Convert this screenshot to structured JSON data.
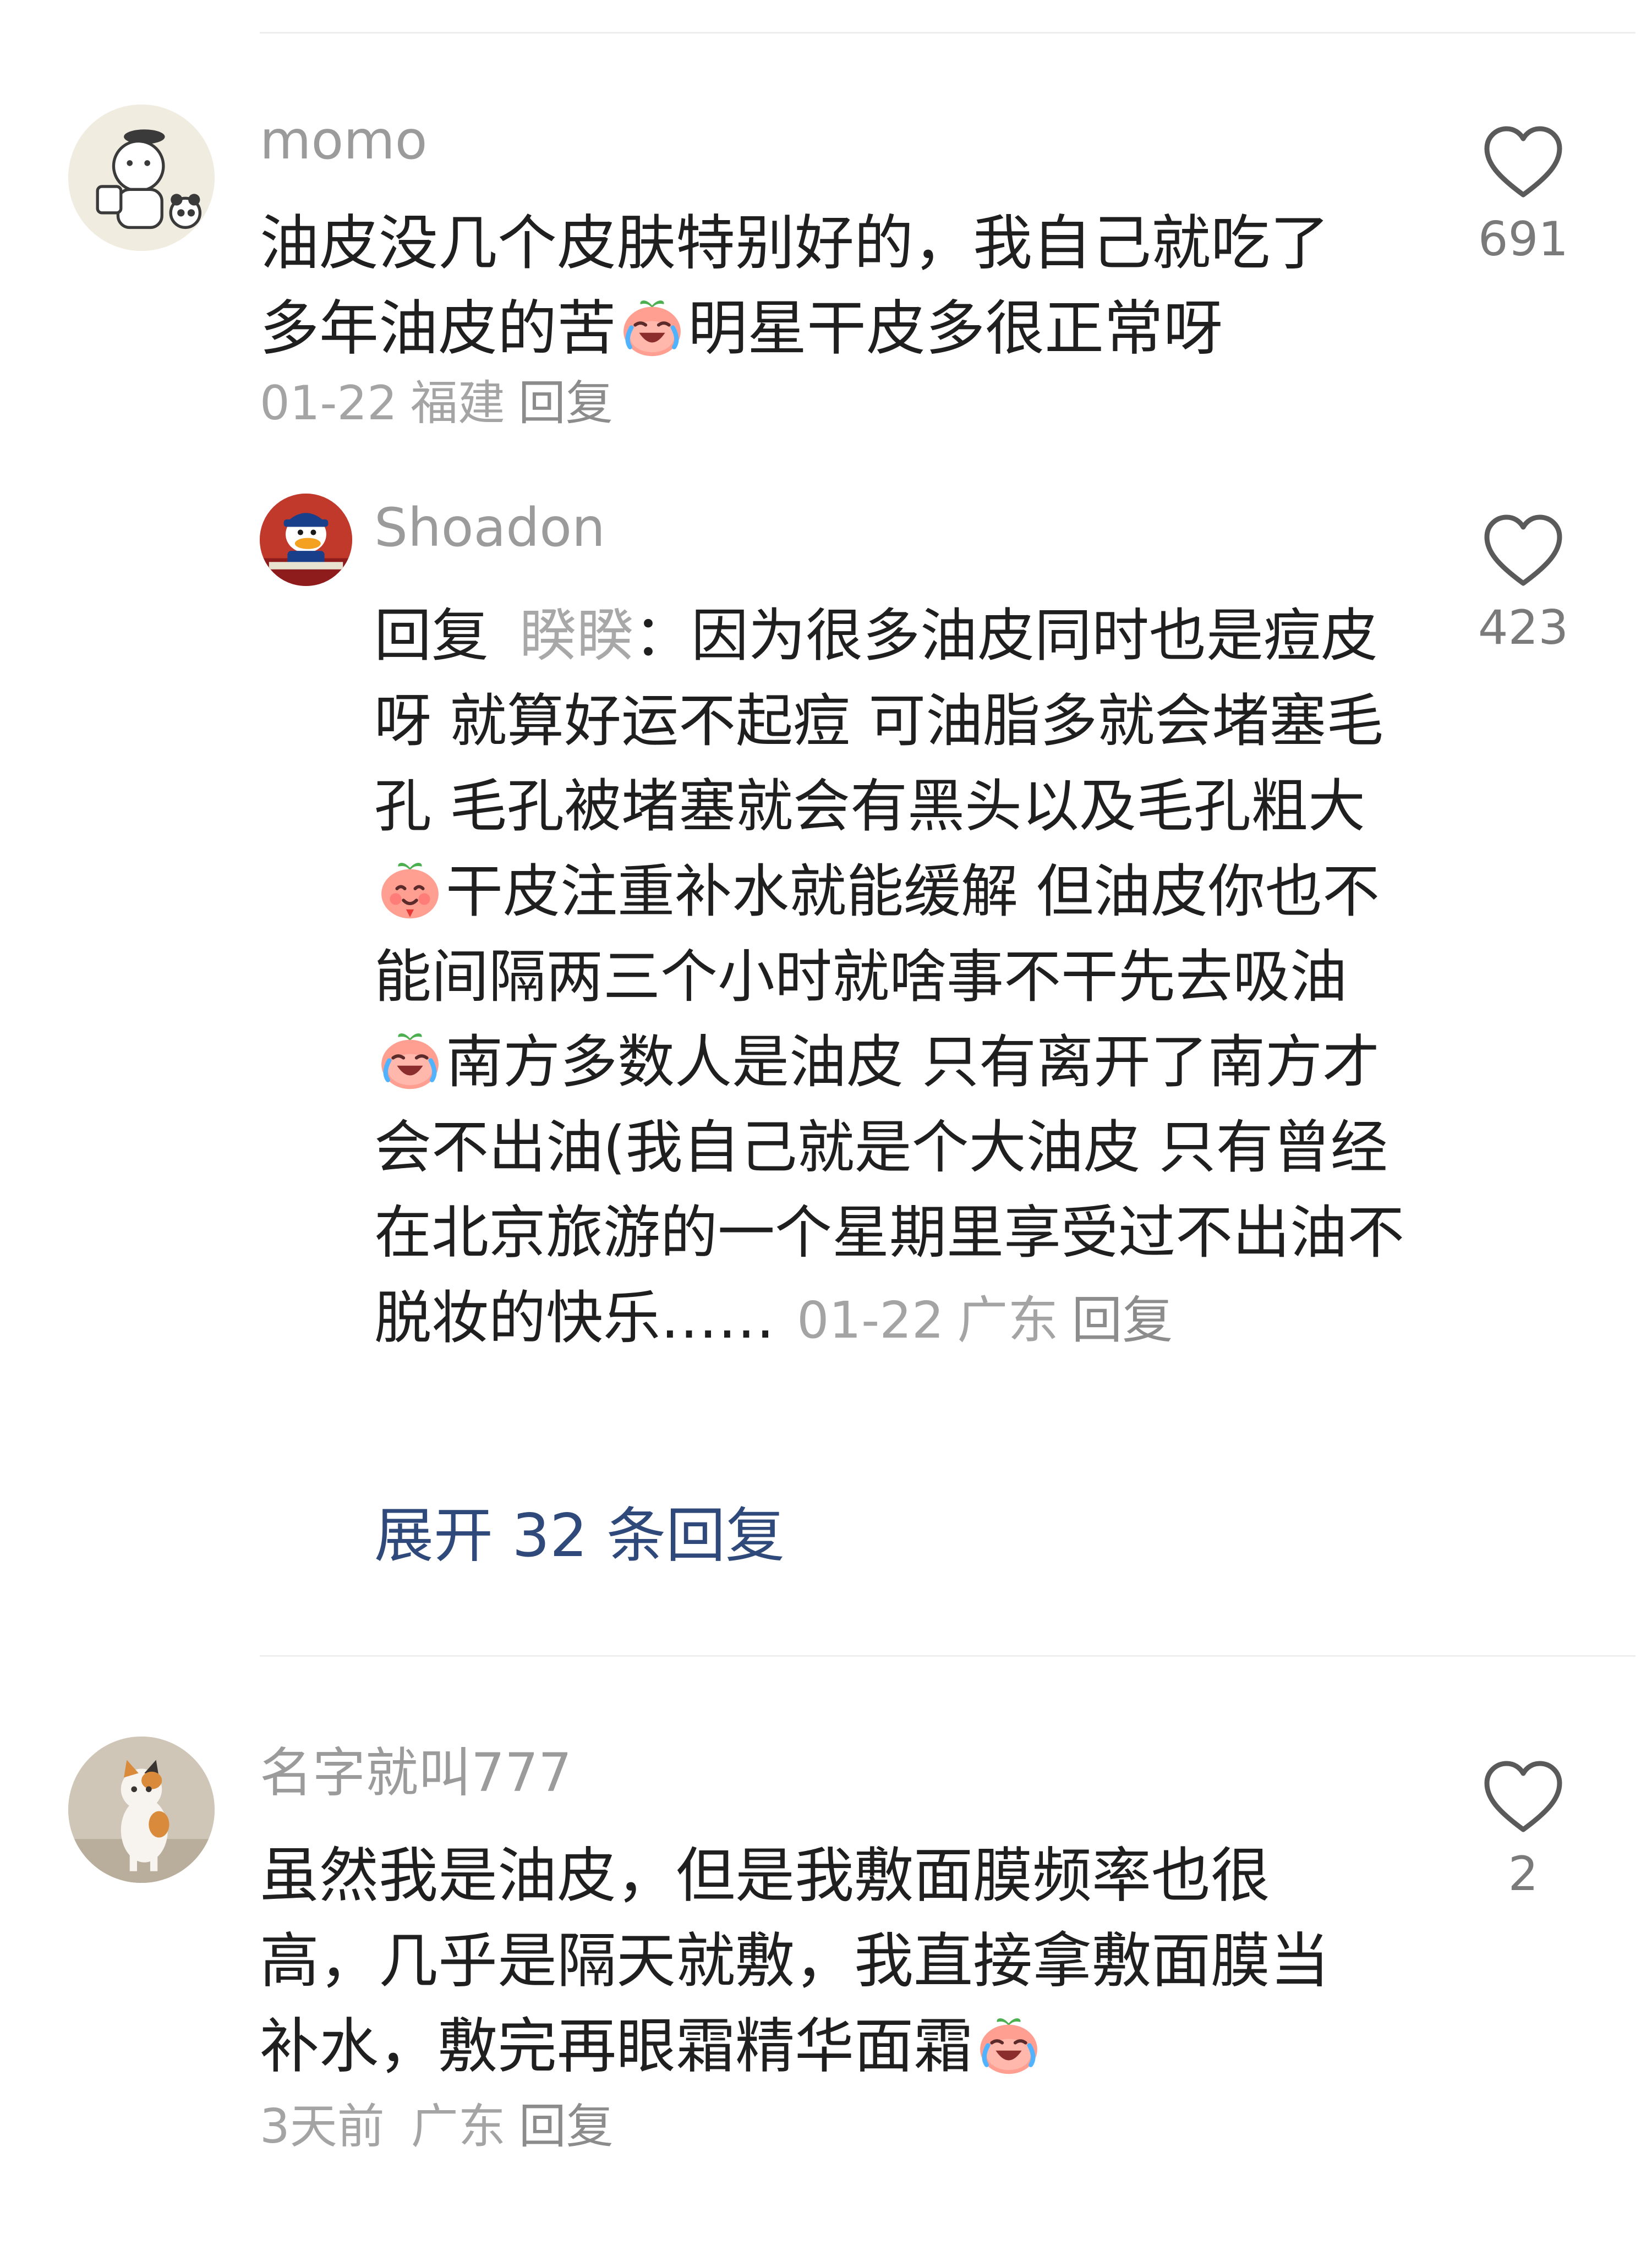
{
  "comments": [
    {
      "username": "momo",
      "text_1": "油皮没几个皮肤特别好的，我自己就吃了多年油皮的苦",
      "emoji_1": "crying-laughing-peach-emoji",
      "text_2": "明星干皮多很正常呀",
      "date": "01-22",
      "location": "福建",
      "reply_label": "回复",
      "like_count": "691",
      "avatar": "cartoon-bear-avatar",
      "replies": [
        {
          "username": "Shoadon",
          "avatar": "donald-duck-avatar",
          "reply_prefix": "回复",
          "reply_to": "睽睽",
          "colon": "：",
          "text_1": "因为很多油皮同时也是痘皮呀 就算好运不起痘 可油脂多就会堵塞毛孔 毛孔被堵塞就会有黑头以及毛孔粗大 ",
          "emoji_1": "blushing-peach-emoji",
          "text_2": "干皮注重补水就能缓解 但油皮你也不能间隔两三个小时就啥事不干先去吸油 ",
          "emoji_2": "crying-laughing-peach-emoji",
          "text_3": "南方多数人是油皮 只有离开了南方才会不出油(我自己就是个大油皮 只有曾经在北京旅游的一个星期里享受过不出油不脱妆的快乐……",
          "date": "01-22",
          "location": "广东",
          "reply_label": "回复",
          "like_count": "423"
        }
      ],
      "expand_label": "展开 32 条回复"
    },
    {
      "username": "名字就叫777",
      "text_1": "虽然我是油皮，但是我敷面膜频率也很高，几乎是隔天就敷，我直接拿敷面膜当补水，敷完再眼霜精华面霜",
      "emoji_1": "crying-laughing-peach-emoji",
      "date": "3天前",
      "location": "广东",
      "reply_label": "回复",
      "like_count": "2",
      "avatar": "cat-photo-avatar"
    }
  ],
  "colors": {
    "username": "#9b9b9b",
    "text": "#1f1f1f",
    "meta": "#a4a4a4",
    "expand_link": "#2f4a7a",
    "divider": "#eeeeee"
  },
  "icons": {
    "like": "heart-outline-icon"
  }
}
